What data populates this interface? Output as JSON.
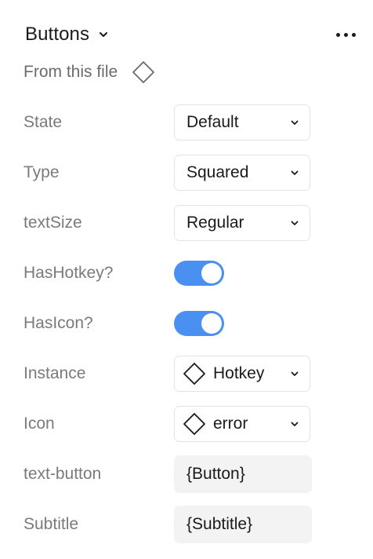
{
  "header": {
    "title": "Buttons",
    "chevron_icon": "chevron-down-icon",
    "more_icon": "more-horizontal-icon"
  },
  "source": {
    "label": "From this file",
    "icon": "component-diamond-icon"
  },
  "properties": [
    {
      "label": "State",
      "kind": "select",
      "value": "Default"
    },
    {
      "label": "Type",
      "kind": "select",
      "value": "Squared"
    },
    {
      "label": "textSize",
      "kind": "select",
      "value": "Regular"
    },
    {
      "label": "HasHotkey?",
      "kind": "toggle",
      "value": true
    },
    {
      "label": "HasIcon?",
      "kind": "toggle",
      "value": true
    },
    {
      "label": "Instance",
      "kind": "instance-select",
      "value": "Hotkey",
      "icon": "component-diamond-icon"
    },
    {
      "label": "Icon",
      "kind": "instance-select",
      "value": "error",
      "icon": "component-diamond-icon"
    },
    {
      "label": "text-button",
      "kind": "text",
      "value": "{Button}"
    },
    {
      "label": "Subtitle",
      "kind": "text",
      "value": "{Subtitle}"
    }
  ],
  "colors": {
    "toggle_on": "#4a90f0",
    "label_text": "#7a7a7a",
    "field_bg": "#f3f3f3"
  }
}
